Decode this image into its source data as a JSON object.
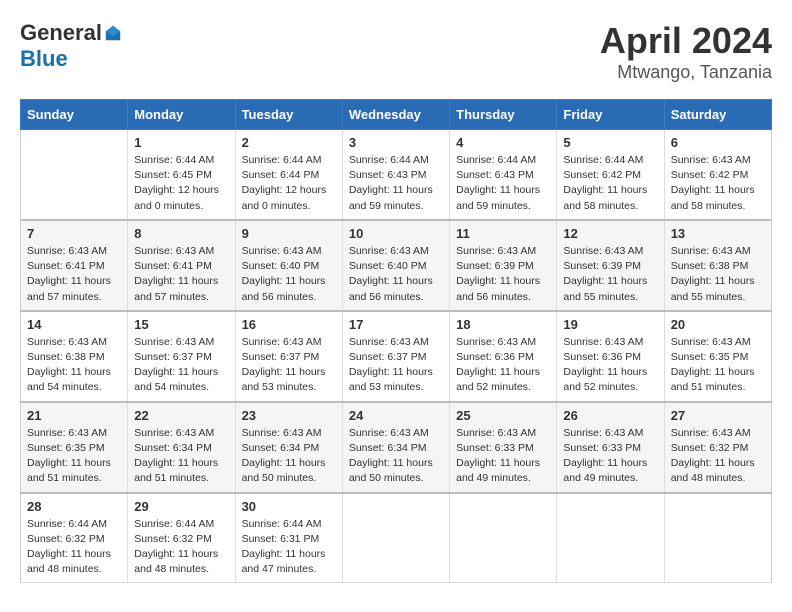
{
  "header": {
    "logo_general": "General",
    "logo_blue": "Blue",
    "month": "April 2024",
    "location": "Mtwango, Tanzania"
  },
  "weekdays": [
    "Sunday",
    "Monday",
    "Tuesday",
    "Wednesday",
    "Thursday",
    "Friday",
    "Saturday"
  ],
  "weeks": [
    [
      {
        "day": "",
        "info": ""
      },
      {
        "day": "1",
        "info": "Sunrise: 6:44 AM\nSunset: 6:45 PM\nDaylight: 12 hours\nand 0 minutes."
      },
      {
        "day": "2",
        "info": "Sunrise: 6:44 AM\nSunset: 6:44 PM\nDaylight: 12 hours\nand 0 minutes."
      },
      {
        "day": "3",
        "info": "Sunrise: 6:44 AM\nSunset: 6:43 PM\nDaylight: 11 hours\nand 59 minutes."
      },
      {
        "day": "4",
        "info": "Sunrise: 6:44 AM\nSunset: 6:43 PM\nDaylight: 11 hours\nand 59 minutes."
      },
      {
        "day": "5",
        "info": "Sunrise: 6:44 AM\nSunset: 6:42 PM\nDaylight: 11 hours\nand 58 minutes."
      },
      {
        "day": "6",
        "info": "Sunrise: 6:43 AM\nSunset: 6:42 PM\nDaylight: 11 hours\nand 58 minutes."
      }
    ],
    [
      {
        "day": "7",
        "info": "Sunrise: 6:43 AM\nSunset: 6:41 PM\nDaylight: 11 hours\nand 57 minutes."
      },
      {
        "day": "8",
        "info": "Sunrise: 6:43 AM\nSunset: 6:41 PM\nDaylight: 11 hours\nand 57 minutes."
      },
      {
        "day": "9",
        "info": "Sunrise: 6:43 AM\nSunset: 6:40 PM\nDaylight: 11 hours\nand 56 minutes."
      },
      {
        "day": "10",
        "info": "Sunrise: 6:43 AM\nSunset: 6:40 PM\nDaylight: 11 hours\nand 56 minutes."
      },
      {
        "day": "11",
        "info": "Sunrise: 6:43 AM\nSunset: 6:39 PM\nDaylight: 11 hours\nand 56 minutes."
      },
      {
        "day": "12",
        "info": "Sunrise: 6:43 AM\nSunset: 6:39 PM\nDaylight: 11 hours\nand 55 minutes."
      },
      {
        "day": "13",
        "info": "Sunrise: 6:43 AM\nSunset: 6:38 PM\nDaylight: 11 hours\nand 55 minutes."
      }
    ],
    [
      {
        "day": "14",
        "info": "Sunrise: 6:43 AM\nSunset: 6:38 PM\nDaylight: 11 hours\nand 54 minutes."
      },
      {
        "day": "15",
        "info": "Sunrise: 6:43 AM\nSunset: 6:37 PM\nDaylight: 11 hours\nand 54 minutes."
      },
      {
        "day": "16",
        "info": "Sunrise: 6:43 AM\nSunset: 6:37 PM\nDaylight: 11 hours\nand 53 minutes."
      },
      {
        "day": "17",
        "info": "Sunrise: 6:43 AM\nSunset: 6:37 PM\nDaylight: 11 hours\nand 53 minutes."
      },
      {
        "day": "18",
        "info": "Sunrise: 6:43 AM\nSunset: 6:36 PM\nDaylight: 11 hours\nand 52 minutes."
      },
      {
        "day": "19",
        "info": "Sunrise: 6:43 AM\nSunset: 6:36 PM\nDaylight: 11 hours\nand 52 minutes."
      },
      {
        "day": "20",
        "info": "Sunrise: 6:43 AM\nSunset: 6:35 PM\nDaylight: 11 hours\nand 51 minutes."
      }
    ],
    [
      {
        "day": "21",
        "info": "Sunrise: 6:43 AM\nSunset: 6:35 PM\nDaylight: 11 hours\nand 51 minutes."
      },
      {
        "day": "22",
        "info": "Sunrise: 6:43 AM\nSunset: 6:34 PM\nDaylight: 11 hours\nand 51 minutes."
      },
      {
        "day": "23",
        "info": "Sunrise: 6:43 AM\nSunset: 6:34 PM\nDaylight: 11 hours\nand 50 minutes."
      },
      {
        "day": "24",
        "info": "Sunrise: 6:43 AM\nSunset: 6:34 PM\nDaylight: 11 hours\nand 50 minutes."
      },
      {
        "day": "25",
        "info": "Sunrise: 6:43 AM\nSunset: 6:33 PM\nDaylight: 11 hours\nand 49 minutes."
      },
      {
        "day": "26",
        "info": "Sunrise: 6:43 AM\nSunset: 6:33 PM\nDaylight: 11 hours\nand 49 minutes."
      },
      {
        "day": "27",
        "info": "Sunrise: 6:43 AM\nSunset: 6:32 PM\nDaylight: 11 hours\nand 48 minutes."
      }
    ],
    [
      {
        "day": "28",
        "info": "Sunrise: 6:44 AM\nSunset: 6:32 PM\nDaylight: 11 hours\nand 48 minutes."
      },
      {
        "day": "29",
        "info": "Sunrise: 6:44 AM\nSunset: 6:32 PM\nDaylight: 11 hours\nand 48 minutes."
      },
      {
        "day": "30",
        "info": "Sunrise: 6:44 AM\nSunset: 6:31 PM\nDaylight: 11 hours\nand 47 minutes."
      },
      {
        "day": "",
        "info": ""
      },
      {
        "day": "",
        "info": ""
      },
      {
        "day": "",
        "info": ""
      },
      {
        "day": "",
        "info": ""
      }
    ]
  ]
}
